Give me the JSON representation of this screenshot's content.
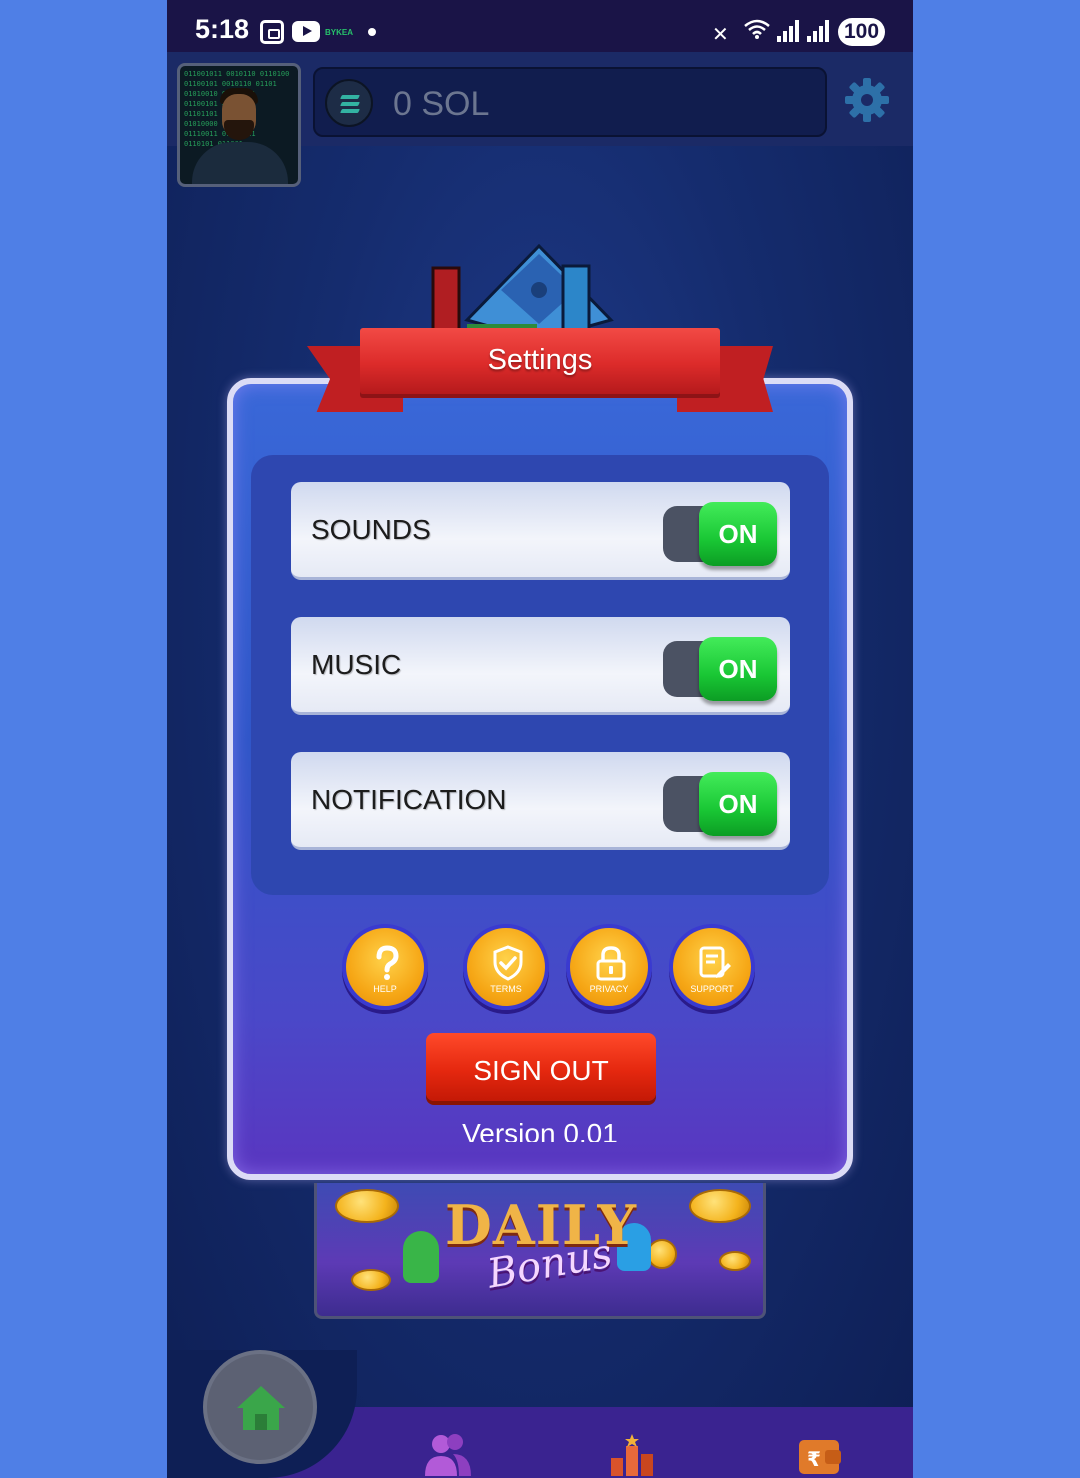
{
  "status_bar": {
    "time": "5:18",
    "app_label": "BYKEA",
    "battery": "100"
  },
  "wallet": {
    "balance": "0 SOL"
  },
  "settings": {
    "title": "Settings",
    "toggles": [
      {
        "label": "SOUNDS",
        "state": "ON"
      },
      {
        "label": "MUSIC",
        "state": "ON"
      },
      {
        "label": "NOTIFICATION",
        "state": "ON"
      }
    ],
    "buttons": [
      {
        "label": "HELP",
        "icon": "help-icon"
      },
      {
        "label": "TERMS",
        "icon": "shield-check-icon"
      },
      {
        "label": "PRIVACY",
        "icon": "lock-icon"
      },
      {
        "label": "SUPPORT",
        "icon": "support-icon"
      }
    ],
    "sign_out": "SIGN OUT",
    "version": "Version 0.01"
  },
  "banner": {
    "title": "DAILY",
    "subtitle": "Bonus"
  },
  "colors": {
    "toggle_on": "#19c634",
    "ribbon": "#dc2b2a",
    "button_orange": "#f6a716",
    "sign_out": "#e5280f",
    "panel": "#2f56c8"
  }
}
